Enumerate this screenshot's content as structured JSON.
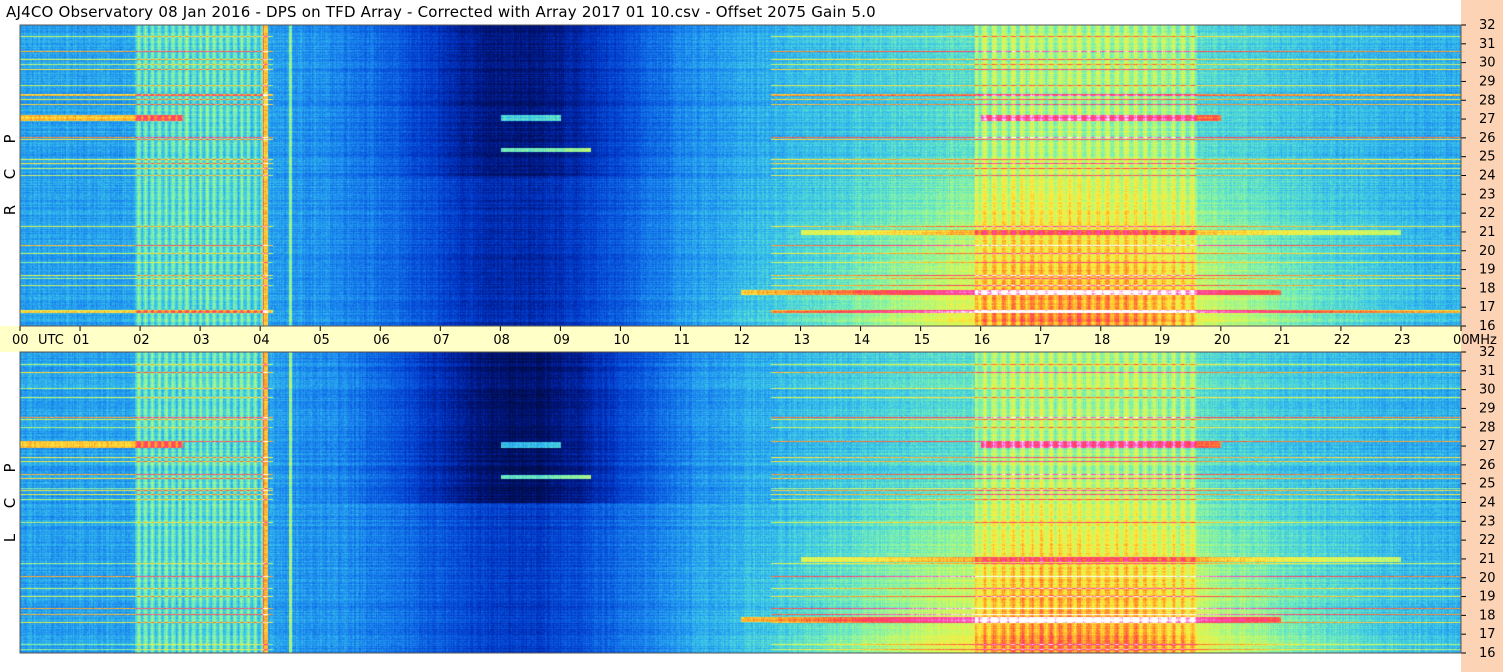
{
  "title": "AJ4CO Observatory  08 Jan 2016  -  DPS on TFD Array  -  Corrected with Array 2017 01 10.csv  -  Offset 2075  Gain 5.0",
  "panels": [
    {
      "name": "RCP",
      "letters": [
        "R",
        "C",
        "P"
      ]
    },
    {
      "name": "LCP",
      "letters": [
        "L",
        "C",
        "P"
      ]
    }
  ],
  "chart_data": {
    "type": "heatmap",
    "title": "AJ4CO Observatory  08 Jan 2016  -  DPS on TFD Array  -  Corrected with Array 2017 01 10.csv  -  Offset 2075  Gain 5.0",
    "x_unit_label": "UTC",
    "y_unit_label": "MHz",
    "x_range": [
      0,
      24
    ],
    "y_range": [
      16,
      32
    ],
    "x_ticks": [
      "00",
      "01",
      "02",
      "03",
      "04",
      "05",
      "06",
      "07",
      "08",
      "09",
      "10",
      "11",
      "12",
      "13",
      "14",
      "15",
      "16",
      "17",
      "18",
      "19",
      "20",
      "21",
      "22",
      "23",
      "00"
    ],
    "y_ticks": [
      "16",
      "17",
      "18",
      "19",
      "20",
      "21",
      "22",
      "23",
      "24",
      "25",
      "26",
      "27",
      "28",
      "29",
      "30",
      "31",
      "32"
    ],
    "series": [
      {
        "name": "R C P"
      },
      {
        "name": "L C P"
      }
    ],
    "colorscale": [
      "#000a3c",
      "#00147a",
      "#0033c2",
      "#0a5ce0",
      "#1e90f0",
      "#3cc8e8",
      "#78f0b4",
      "#c8fa64",
      "#ffeb3c",
      "#ff9a28",
      "#ff3c50",
      "#ff50c8",
      "#ffffff"
    ]
  }
}
